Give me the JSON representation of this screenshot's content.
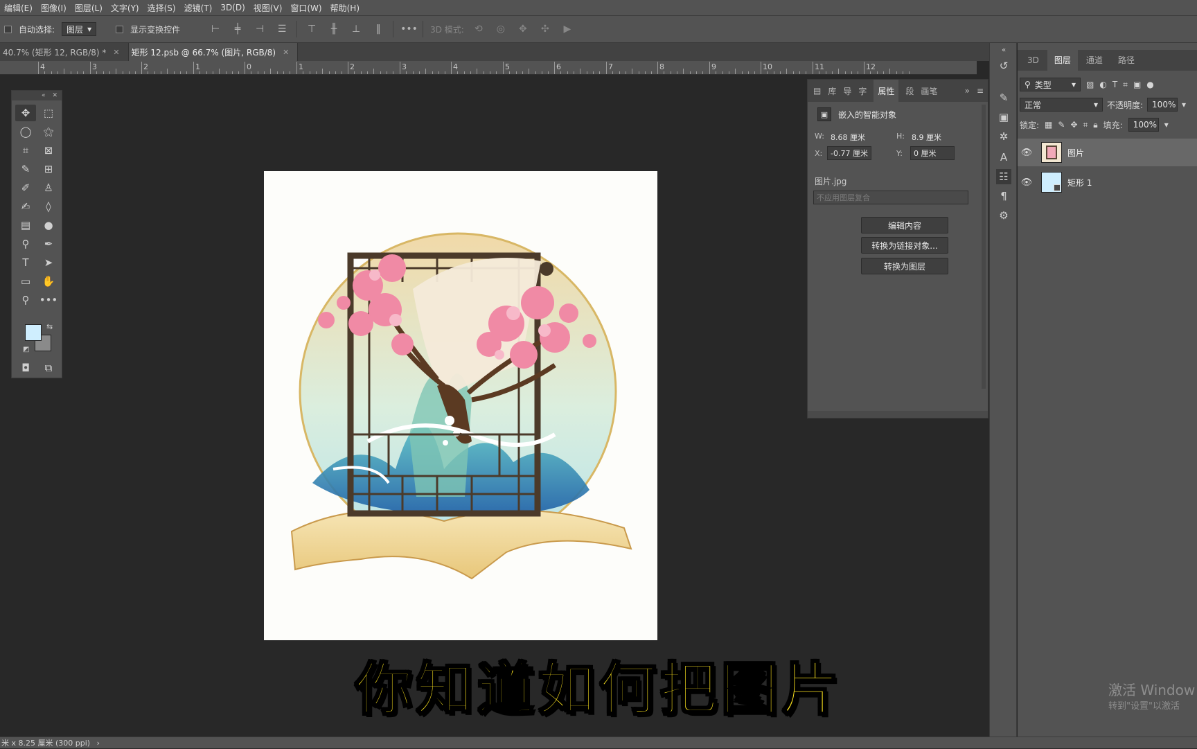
{
  "menubar": {
    "items": [
      "编辑(E)",
      "图像(I)",
      "图层(L)",
      "文字(Y)",
      "选择(S)",
      "滤镜(T)",
      "3D(D)",
      "视图(V)",
      "窗口(W)",
      "帮助(H)"
    ]
  },
  "options": {
    "auto_select_label": "自动选择:",
    "auto_select_value": "图层",
    "show_transform_label": "显示变换控件",
    "mode_3d_label": "3D 模式:"
  },
  "tabs": [
    {
      "label": "40.7% (矩形 12, RGB/8) *"
    },
    {
      "label": "矩形 12.psb @ 66.7% (图片, RGB/8)"
    }
  ],
  "ruler": {
    "numbers": [
      "4",
      "3",
      "2",
      "1",
      "0",
      "1",
      "2",
      "3",
      "4",
      "5",
      "6",
      "7",
      "8",
      "9",
      "10",
      "11",
      "12"
    ]
  },
  "properties": {
    "tabs": [
      "库",
      "导",
      "字",
      "属性",
      "段",
      "画笔"
    ],
    "active_tab": "属性",
    "object_type": "嵌入的智能对象",
    "w_label": "W:",
    "w_value": "8.68 厘米",
    "h_label": "H:",
    "h_value": "8.9 厘米",
    "x_label": "X:",
    "x_value": "-0.77 厘米",
    "y_label": "Y:",
    "y_value": "0 厘米",
    "filename": "图片.jpg",
    "comp_placeholder": "不应用图层复合",
    "btn_edit": "编辑内容",
    "btn_convert_linked": "转换为链接对象...",
    "btn_convert_layer": "转换为图层"
  },
  "layers": {
    "tabs": [
      "3D",
      "图层",
      "通道",
      "路径"
    ],
    "active_tab": "图层",
    "filter_label": "类型",
    "blend_mode": "正常",
    "opacity_label": "不透明度:",
    "opacity_value": "100%",
    "lock_label": "锁定:",
    "fill_label": "填充:",
    "fill_value": "100%",
    "items": [
      {
        "name": "图片",
        "selected": true
      },
      {
        "name": "矩形 1",
        "selected": false
      }
    ]
  },
  "status": {
    "text": "米 x 8.25 厘米 (300 ppi)"
  },
  "subtitle": "你知道如何把图片",
  "watermark": {
    "line1": "激活 Window",
    "line2": "转到\"设置\"以激活"
  },
  "colors": {
    "foreground": "#cfeefe",
    "background": "#8a8a8a",
    "subtitle": "#ffe61e"
  }
}
